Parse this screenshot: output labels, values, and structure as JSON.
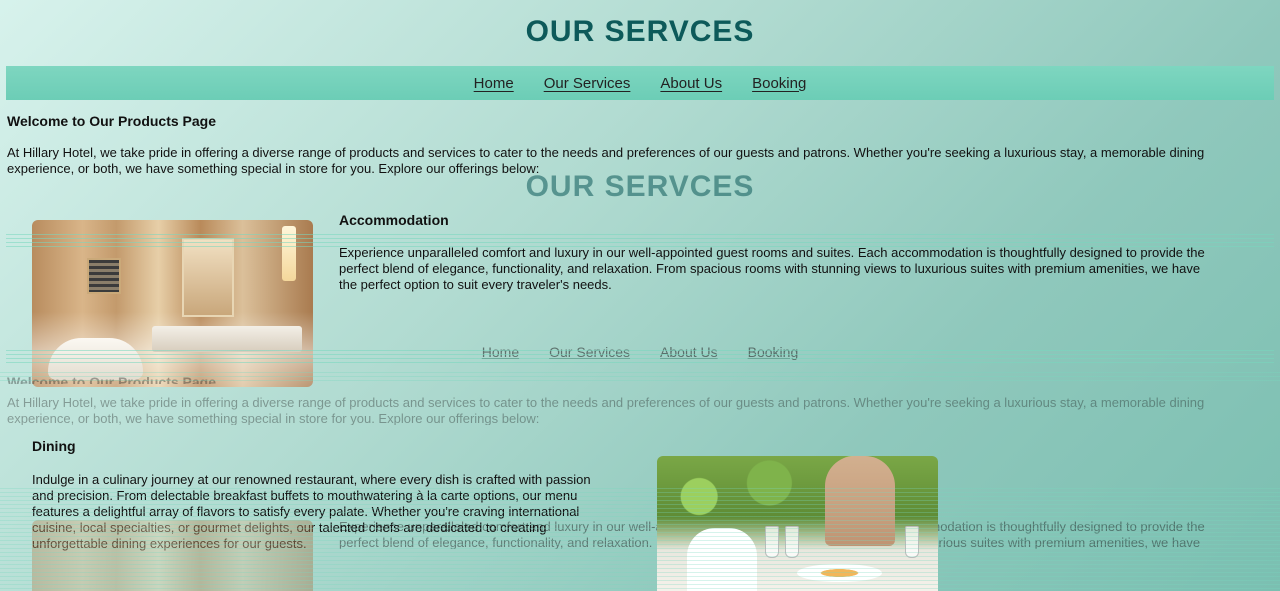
{
  "page": {
    "title": "OUR SERVCES"
  },
  "nav": {
    "items": [
      {
        "label": "Home"
      },
      {
        "label": "Our Services"
      },
      {
        "label": "About Us"
      },
      {
        "label": "Booking"
      }
    ]
  },
  "intro": {
    "heading": "Welcome to Our Products Page",
    "text": "At Hillary Hotel, we take pride in offering a diverse range of products and services to cater to the needs and preferences of our guests and patrons. Whether you're seeking a luxurious stay, a memorable dining experience, or both, we have something special in store for you. Explore our offerings below:"
  },
  "sections": {
    "accommodation": {
      "heading": "Accommodation",
      "text": "Experience unparalleled comfort and luxury in our well-appointed guest rooms and suites. Each accommodation is thoughtfully designed to provide the perfect blend of elegance, functionality, and relaxation. From spacious rooms with stunning views to luxurious suites with premium amenities, we have the perfect option to suit every traveler's needs."
    },
    "dining": {
      "heading": "Dining",
      "text": "Indulge in a culinary journey at our renowned restaurant, where every dish is crafted with passion and precision. From delectable breakfast buffets to mouthwatering à la carte options, our menu features a delightful array of flavors to satisfy every palate. Whether you're craving international cuisine, local specialties, or gourmet delights, our talented chefs are dedicated to creating unforgettable dining experiences for our guests."
    }
  }
}
